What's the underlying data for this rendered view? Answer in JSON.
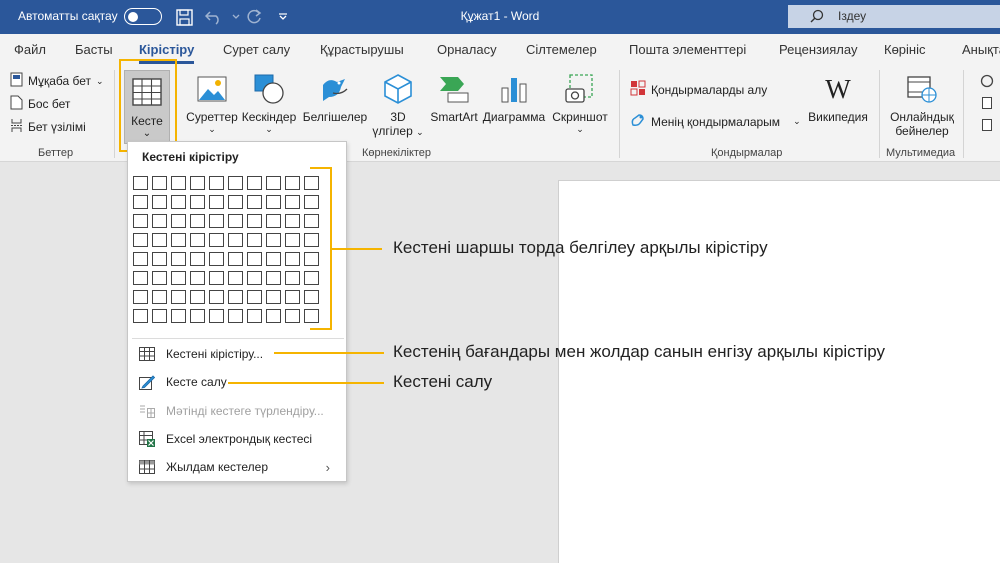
{
  "titlebar": {
    "autosave_label": "Автоматты сақтау",
    "doc_title": "Құжат1  -  Word",
    "search_placeholder": "Іздеу"
  },
  "tabs": [
    {
      "label": "Файл",
      "active": false
    },
    {
      "label": "Басты",
      "active": false
    },
    {
      "label": "Кірістіру",
      "active": true
    },
    {
      "label": "Сурет салу",
      "active": false
    },
    {
      "label": "Құрастырушы",
      "active": false
    },
    {
      "label": "Орналасу",
      "active": false
    },
    {
      "label": "Сілтемелер",
      "active": false
    },
    {
      "label": "Пошта элементтері",
      "active": false
    },
    {
      "label": "Рецензиялау",
      "active": false
    },
    {
      "label": "Көрініс",
      "active": false
    },
    {
      "label": "Анықтама",
      "active": false
    }
  ],
  "ribbon": {
    "pages_group": {
      "cover": "Мұқаба бет",
      "blank": "Бос бет",
      "break": "Бет үзілімі",
      "label": "Беттер"
    },
    "table_button": "Кесте",
    "illustrations": {
      "pictures": "Суреттер",
      "shapes": "Кескіндер",
      "icons": "Белгішелер",
      "models_line1": "3D",
      "models_line2": "үлгілер",
      "smartart": "SmartArt",
      "chart": "Диаграмма",
      "screenshot": "Скриншот",
      "label": "Көрнекіліктер"
    },
    "addins": {
      "get": "Қондырмаларды алу",
      "my": "Менің қондырмаларым",
      "wikipedia": "Википедия",
      "label": "Қондырмалар"
    },
    "media": {
      "online_line1": "Онлайндық",
      "online_line2": "бейнелер",
      "label": "Мультимедиа"
    }
  },
  "dropdown": {
    "title": "Кестені кірістіру",
    "items": [
      {
        "label": "Кестені кірістіру...",
        "disabled": false
      },
      {
        "label": "Кесте салу",
        "disabled": false
      },
      {
        "label": "Мәтінді кестеге түрлендіру...",
        "disabled": true
      },
      {
        "label": "Excel электрондық кестесі",
        "disabled": false
      },
      {
        "label": "Жылдам кестелер",
        "disabled": false
      }
    ]
  },
  "annotations": {
    "grid": "Кестені шаршы торда белгілеу арқылы кірістіру",
    "insert_dialog": "Кестенің бағандары мен жолдар санын енгізу арқылы кірістіру",
    "draw": "Кестені салу"
  },
  "colors": {
    "brand": "#2b579a",
    "highlight": "#f5b400"
  }
}
